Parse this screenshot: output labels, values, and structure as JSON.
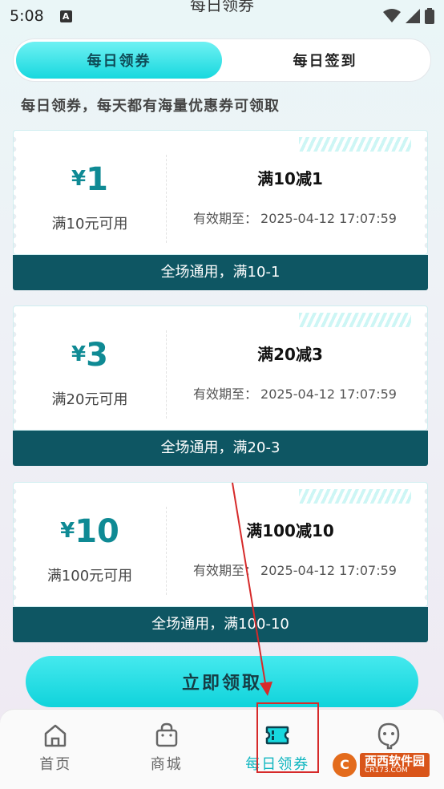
{
  "status_bar": {
    "time": "5:08",
    "notification_badge": "A"
  },
  "header": {
    "title": "每日领券"
  },
  "tabs": [
    {
      "label": "每日领券",
      "active": true
    },
    {
      "label": "每日签到",
      "active": false
    }
  ],
  "subtitle": "每日领券，每天都有海量优惠券可领取",
  "coupons": [
    {
      "currency": "¥",
      "amount": "1",
      "condition": "满10元可用",
      "name": "满10减1",
      "expiry_label": "有效期至：",
      "expiry": "2025-04-12 17:07:59",
      "scope": "全场通用，满10-1"
    },
    {
      "currency": "¥",
      "amount": "3",
      "condition": "满20元可用",
      "name": "满20减3",
      "expiry_label": "有效期至：",
      "expiry": "2025-04-12 17:07:59",
      "scope": "全场通用，满20-3"
    },
    {
      "currency": "¥",
      "amount": "10",
      "condition": "满100元可用",
      "name": "满100减10",
      "expiry_label": "有效期至：",
      "expiry": "2025-04-12 17:07:59",
      "scope": "全场通用，满100-10"
    }
  ],
  "claim_button": "立即领取",
  "bottom_nav": [
    {
      "label": "首页",
      "icon": "home-icon",
      "active": false
    },
    {
      "label": "商城",
      "icon": "shopping-bag-icon",
      "active": false
    },
    {
      "label": "每日领券",
      "icon": "ticket-icon",
      "active": true
    },
    {
      "label": "",
      "icon": "profile-icon",
      "active": false
    }
  ],
  "watermark": {
    "logo": "C",
    "name": "西西软件园",
    "url": "CR173.COM"
  },
  "colors": {
    "accent": "#17d8de",
    "dark_teal": "#0e5663",
    "amount": "#0f8a94",
    "annotation_red": "#d62a2a"
  }
}
